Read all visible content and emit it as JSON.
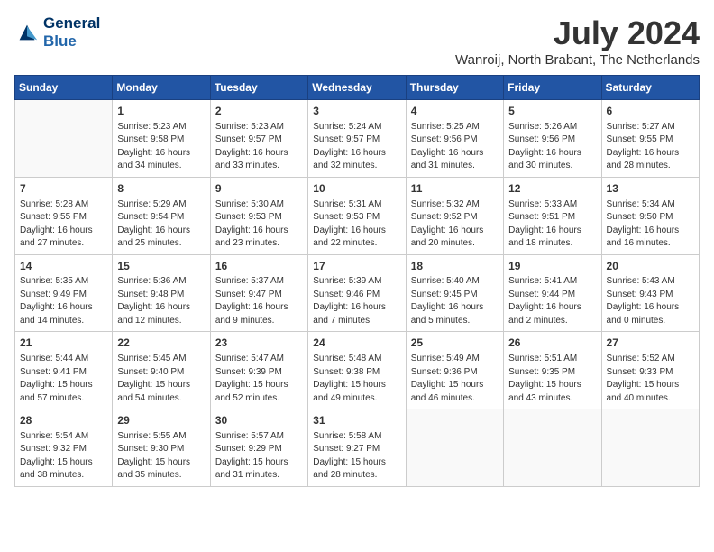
{
  "header": {
    "logo_line1": "General",
    "logo_line2": "Blue",
    "month_title": "July 2024",
    "location": "Wanroij, North Brabant, The Netherlands"
  },
  "days_of_week": [
    "Sunday",
    "Monday",
    "Tuesday",
    "Wednesday",
    "Thursday",
    "Friday",
    "Saturday"
  ],
  "weeks": [
    [
      {
        "day": "",
        "info": ""
      },
      {
        "day": "1",
        "info": "Sunrise: 5:23 AM\nSunset: 9:58 PM\nDaylight: 16 hours\nand 34 minutes."
      },
      {
        "day": "2",
        "info": "Sunrise: 5:23 AM\nSunset: 9:57 PM\nDaylight: 16 hours\nand 33 minutes."
      },
      {
        "day": "3",
        "info": "Sunrise: 5:24 AM\nSunset: 9:57 PM\nDaylight: 16 hours\nand 32 minutes."
      },
      {
        "day": "4",
        "info": "Sunrise: 5:25 AM\nSunset: 9:56 PM\nDaylight: 16 hours\nand 31 minutes."
      },
      {
        "day": "5",
        "info": "Sunrise: 5:26 AM\nSunset: 9:56 PM\nDaylight: 16 hours\nand 30 minutes."
      },
      {
        "day": "6",
        "info": "Sunrise: 5:27 AM\nSunset: 9:55 PM\nDaylight: 16 hours\nand 28 minutes."
      }
    ],
    [
      {
        "day": "7",
        "info": "Sunrise: 5:28 AM\nSunset: 9:55 PM\nDaylight: 16 hours\nand 27 minutes."
      },
      {
        "day": "8",
        "info": "Sunrise: 5:29 AM\nSunset: 9:54 PM\nDaylight: 16 hours\nand 25 minutes."
      },
      {
        "day": "9",
        "info": "Sunrise: 5:30 AM\nSunset: 9:53 PM\nDaylight: 16 hours\nand 23 minutes."
      },
      {
        "day": "10",
        "info": "Sunrise: 5:31 AM\nSunset: 9:53 PM\nDaylight: 16 hours\nand 22 minutes."
      },
      {
        "day": "11",
        "info": "Sunrise: 5:32 AM\nSunset: 9:52 PM\nDaylight: 16 hours\nand 20 minutes."
      },
      {
        "day": "12",
        "info": "Sunrise: 5:33 AM\nSunset: 9:51 PM\nDaylight: 16 hours\nand 18 minutes."
      },
      {
        "day": "13",
        "info": "Sunrise: 5:34 AM\nSunset: 9:50 PM\nDaylight: 16 hours\nand 16 minutes."
      }
    ],
    [
      {
        "day": "14",
        "info": "Sunrise: 5:35 AM\nSunset: 9:49 PM\nDaylight: 16 hours\nand 14 minutes."
      },
      {
        "day": "15",
        "info": "Sunrise: 5:36 AM\nSunset: 9:48 PM\nDaylight: 16 hours\nand 12 minutes."
      },
      {
        "day": "16",
        "info": "Sunrise: 5:37 AM\nSunset: 9:47 PM\nDaylight: 16 hours\nand 9 minutes."
      },
      {
        "day": "17",
        "info": "Sunrise: 5:39 AM\nSunset: 9:46 PM\nDaylight: 16 hours\nand 7 minutes."
      },
      {
        "day": "18",
        "info": "Sunrise: 5:40 AM\nSunset: 9:45 PM\nDaylight: 16 hours\nand 5 minutes."
      },
      {
        "day": "19",
        "info": "Sunrise: 5:41 AM\nSunset: 9:44 PM\nDaylight: 16 hours\nand 2 minutes."
      },
      {
        "day": "20",
        "info": "Sunrise: 5:43 AM\nSunset: 9:43 PM\nDaylight: 16 hours\nand 0 minutes."
      }
    ],
    [
      {
        "day": "21",
        "info": "Sunrise: 5:44 AM\nSunset: 9:41 PM\nDaylight: 15 hours\nand 57 minutes."
      },
      {
        "day": "22",
        "info": "Sunrise: 5:45 AM\nSunset: 9:40 PM\nDaylight: 15 hours\nand 54 minutes."
      },
      {
        "day": "23",
        "info": "Sunrise: 5:47 AM\nSunset: 9:39 PM\nDaylight: 15 hours\nand 52 minutes."
      },
      {
        "day": "24",
        "info": "Sunrise: 5:48 AM\nSunset: 9:38 PM\nDaylight: 15 hours\nand 49 minutes."
      },
      {
        "day": "25",
        "info": "Sunrise: 5:49 AM\nSunset: 9:36 PM\nDaylight: 15 hours\nand 46 minutes."
      },
      {
        "day": "26",
        "info": "Sunrise: 5:51 AM\nSunset: 9:35 PM\nDaylight: 15 hours\nand 43 minutes."
      },
      {
        "day": "27",
        "info": "Sunrise: 5:52 AM\nSunset: 9:33 PM\nDaylight: 15 hours\nand 40 minutes."
      }
    ],
    [
      {
        "day": "28",
        "info": "Sunrise: 5:54 AM\nSunset: 9:32 PM\nDaylight: 15 hours\nand 38 minutes."
      },
      {
        "day": "29",
        "info": "Sunrise: 5:55 AM\nSunset: 9:30 PM\nDaylight: 15 hours\nand 35 minutes."
      },
      {
        "day": "30",
        "info": "Sunrise: 5:57 AM\nSunset: 9:29 PM\nDaylight: 15 hours\nand 31 minutes."
      },
      {
        "day": "31",
        "info": "Sunrise: 5:58 AM\nSunset: 9:27 PM\nDaylight: 15 hours\nand 28 minutes."
      },
      {
        "day": "",
        "info": ""
      },
      {
        "day": "",
        "info": ""
      },
      {
        "day": "",
        "info": ""
      }
    ]
  ]
}
